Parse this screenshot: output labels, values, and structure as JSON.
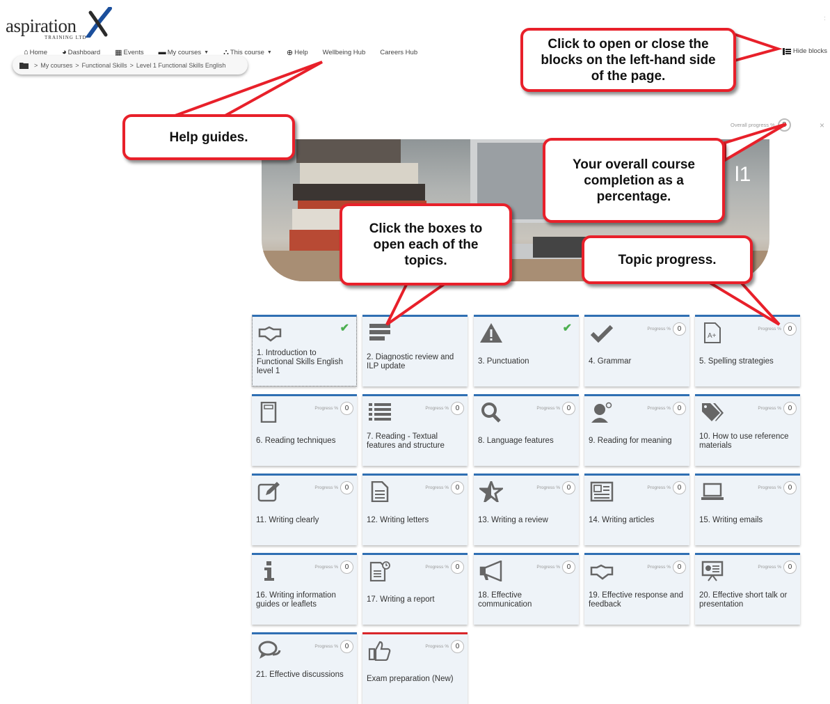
{
  "logo": {
    "word": "aspiration",
    "sub": "TRAINING   LTD"
  },
  "nav": {
    "home": "Home",
    "dashboard": "Dashboard",
    "events": "Events",
    "my_courses": "My courses",
    "this_course": "This course",
    "help": "Help",
    "wellbeing": "Wellbeing Hub",
    "careers": "Careers Hub",
    "hide_blocks": "Hide blocks"
  },
  "breadcrumb": {
    "items": [
      "My courses",
      "Functional Skills",
      "Level 1 Functional Skills English"
    ],
    "sep": ">"
  },
  "overall": {
    "label": "Overall progress %",
    "value": "8"
  },
  "close_symbol": "×",
  "progress_label": "Progress %",
  "banner_text": "l1",
  "tiles": [
    {
      "name": "1. Introduction to Functional Skills English level 1",
      "icon": "handshake-icon",
      "done": true,
      "progress": ""
    },
    {
      "name": "2. Diagnostic review and ILP update",
      "icon": "list-lines-icon",
      "done": false,
      "progress": ""
    },
    {
      "name": "3. Punctuation",
      "icon": "warning-icon",
      "done": true,
      "progress": ""
    },
    {
      "name": "4. Grammar",
      "icon": "checkmark-icon",
      "done": false,
      "progress": "0"
    },
    {
      "name": "5. Spelling strategies",
      "icon": "grade-file-icon",
      "done": false,
      "progress": "0"
    },
    {
      "name": "6. Reading techniques",
      "icon": "book-icon",
      "done": false,
      "progress": "0"
    },
    {
      "name": "7. Reading - Textual features and structure",
      "icon": "bullet-list-icon",
      "done": false,
      "progress": "0"
    },
    {
      "name": "8. Language features",
      "icon": "magnifier-icon",
      "done": false,
      "progress": "0"
    },
    {
      "name": "9. Reading for meaning",
      "icon": "person-idea-icon",
      "done": false,
      "progress": "0"
    },
    {
      "name": "10. How to use reference materials",
      "icon": "tags-icon",
      "done": false,
      "progress": "0"
    },
    {
      "name": "11. Writing clearly",
      "icon": "pencil-icon",
      "done": false,
      "progress": "0"
    },
    {
      "name": "12. Writing letters",
      "icon": "document-icon",
      "done": false,
      "progress": "0"
    },
    {
      "name": "13. Writing a review",
      "icon": "star-icon",
      "done": false,
      "progress": "0"
    },
    {
      "name": "14. Writing articles",
      "icon": "newspaper-icon",
      "done": false,
      "progress": "0"
    },
    {
      "name": "15. Writing emails",
      "icon": "laptop-icon",
      "done": false,
      "progress": "0"
    },
    {
      "name": "16. Writing information guides or leaflets",
      "icon": "info-icon",
      "done": false,
      "progress": "0"
    },
    {
      "name": "17. Writing a report",
      "icon": "report-icon",
      "done": false,
      "progress": "0"
    },
    {
      "name": "18. Effective communication",
      "icon": "megaphone-icon",
      "done": false,
      "progress": "0"
    },
    {
      "name": "19. Effective response and feedback",
      "icon": "handshake-icon",
      "done": false,
      "progress": "0"
    },
    {
      "name": "20. Effective short talk or presentation",
      "icon": "presentation-icon",
      "done": false,
      "progress": "0"
    },
    {
      "name": "21. Effective discussions",
      "icon": "speech-bubbles-icon",
      "done": false,
      "progress": "0"
    },
    {
      "name": "Exam preparation (New)",
      "icon": "thumbs-up-icon",
      "done": false,
      "progress": "0"
    }
  ],
  "callouts": {
    "hide_blocks": "Click to open or close the blocks on the left-hand side of the page.",
    "help": "Help guides.",
    "overall": "Your overall course completion as a percentage.",
    "topics": "Click the boxes to open each of the topics.",
    "topic_progress": "Topic progress."
  },
  "colors": {
    "accent": "#2f6fb3",
    "callout_border": "#e8202a",
    "check": "#4caf50",
    "exam_accent": "#d9262a"
  }
}
